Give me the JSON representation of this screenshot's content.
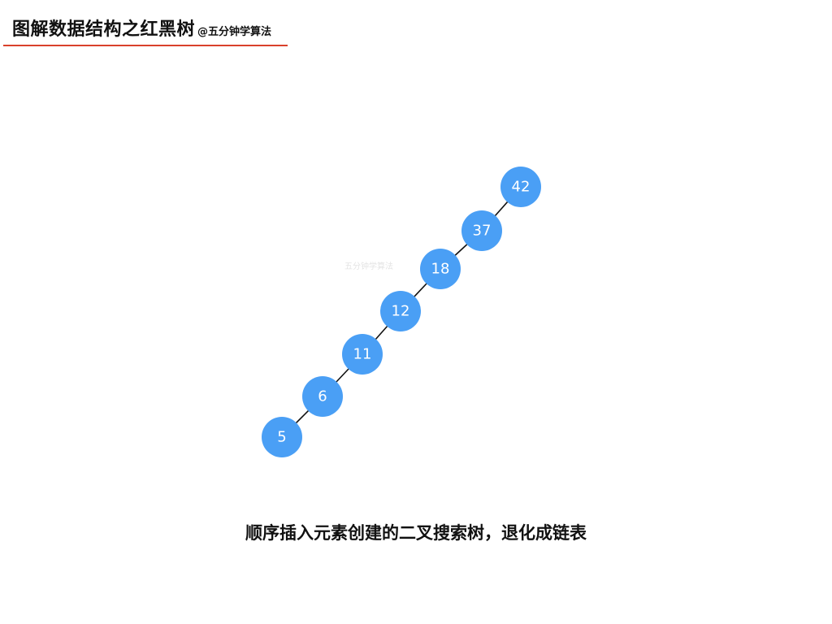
{
  "header": {
    "title": "图解数据结构之红黑树",
    "author": "@五分钟学算法"
  },
  "watermark": "五分钟学算法",
  "tree": {
    "nodes": [
      "42",
      "37",
      "18",
      "12",
      "11",
      "6",
      "5"
    ],
    "node_color": "#4a9ff5",
    "label_color": "#ffffff",
    "edge_color": "#111111"
  },
  "caption": "顺序插入元素创建的二叉搜索树，退化成链表",
  "colors": {
    "accent_rule": "#d9412b",
    "background": "#ffffff"
  }
}
